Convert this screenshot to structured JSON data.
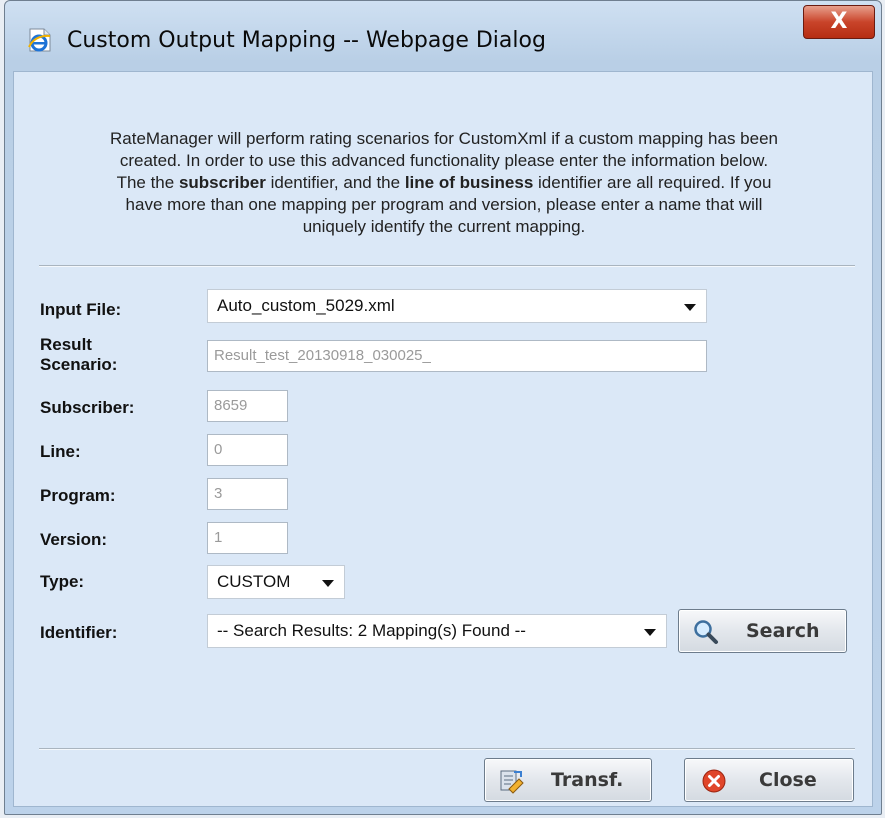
{
  "window": {
    "title": "Custom Output Mapping -- Webpage Dialog",
    "close_glyph": "X"
  },
  "intro": {
    "line1": "RateManager will perform rating scenarios for CustomXml if a custom mapping has been",
    "line2": "created. In order to use this advanced functionality please enter the information below.",
    "line3_a": "The the ",
    "line3_b": "subscriber",
    "line3_c": " identifier, and the ",
    "line3_d": "line of business",
    "line3_e": " identifier are all required. If you",
    "line4": "have more than one mapping per program and version, please enter a name that will",
    "line5": "uniquely identify the current mapping."
  },
  "form": {
    "input_file": {
      "label": "Input File:",
      "value": "Auto_custom_5029.xml"
    },
    "result_scenario": {
      "label_line1": "Result",
      "label_line2": "Scenario:",
      "placeholder": "Result_test_20130918_030025_"
    },
    "subscriber": {
      "label": "Subscriber:",
      "value": "8659"
    },
    "line": {
      "label": "Line:",
      "value": "0"
    },
    "program": {
      "label": "Program:",
      "value": "3"
    },
    "version": {
      "label": "Version:",
      "value": "1"
    },
    "type": {
      "label": "Type:",
      "value": "CUSTOM"
    },
    "identifier": {
      "label": "Identifier:",
      "value": "-- Search Results: 2 Mapping(s) Found --"
    }
  },
  "buttons": {
    "search": "Search",
    "transf": "Transf.",
    "close": "Close"
  },
  "icons": {
    "title": "ie-page-icon",
    "search": "magnifier-icon",
    "transf": "transform-icon",
    "close": "red-x-icon"
  },
  "colors": {
    "dialog_background": "#dbe8f7",
    "close_button_red": "#c9442a",
    "placeholder_text": "#9a9a9a"
  }
}
